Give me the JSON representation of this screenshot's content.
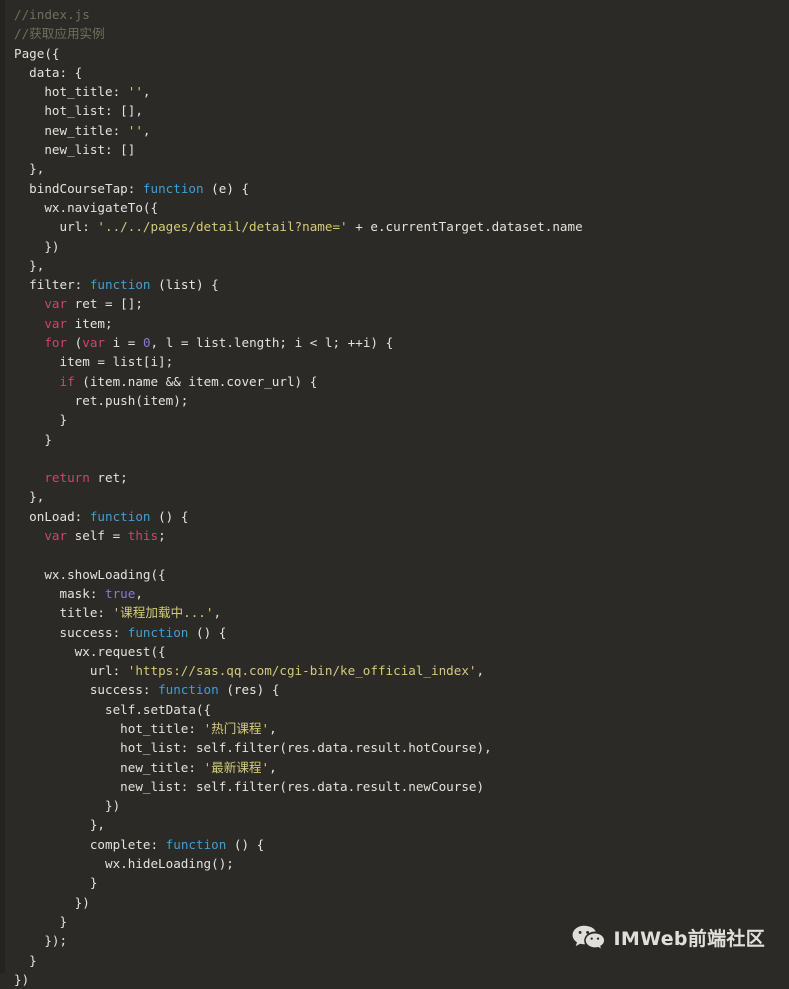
{
  "editor": {
    "language": "javascript",
    "theme_background": "#2b2a26",
    "default_text_color": "#e4e2db",
    "token_colors": {
      "comment": "#6f6f5d",
      "keyword": "#d2436b",
      "function": "#3f9fd6",
      "string": "#d3cb7a",
      "number": "#8a7ad6",
      "parameter": "#c9456a",
      "plain": "#e4e2db"
    }
  },
  "watermark": {
    "icon": "wechat-logo-icon",
    "label": "IMWeb前端社区"
  },
  "code": {
    "lines": [
      [
        {
          "t": "//index.js",
          "c": "comment"
        }
      ],
      [
        {
          "t": "//获取应用实例",
          "c": "comment"
        }
      ],
      [
        {
          "t": "Page({",
          "c": "plain"
        }
      ],
      [
        {
          "t": "  data: {",
          "c": "plain"
        }
      ],
      [
        {
          "t": "    hot_title: ",
          "c": "plain"
        },
        {
          "t": "''",
          "c": "string"
        },
        {
          "t": ",",
          "c": "plain"
        }
      ],
      [
        {
          "t": "    hot_list: [],",
          "c": "plain"
        }
      ],
      [
        {
          "t": "    new_title: ",
          "c": "plain"
        },
        {
          "t": "''",
          "c": "string"
        },
        {
          "t": ",",
          "c": "plain"
        }
      ],
      [
        {
          "t": "    new_list: []",
          "c": "plain"
        }
      ],
      [
        {
          "t": "  },",
          "c": "plain"
        }
      ],
      [
        {
          "t": "  bindCourseTap: ",
          "c": "plain"
        },
        {
          "t": "function",
          "c": "function"
        },
        {
          "t": " ",
          "c": "plain"
        },
        {
          "t": "(e)",
          "c": "parameter"
        },
        {
          "t": " {",
          "c": "plain"
        }
      ],
      [
        {
          "t": "    wx.navigateTo({",
          "c": "plain"
        }
      ],
      [
        {
          "t": "      url: ",
          "c": "plain"
        },
        {
          "t": "'../../pages/detail/detail?name='",
          "c": "string"
        },
        {
          "t": " + e.currentTarget.dataset.name",
          "c": "plain"
        }
      ],
      [
        {
          "t": "    })",
          "c": "plain"
        }
      ],
      [
        {
          "t": "  },",
          "c": "plain"
        }
      ],
      [
        {
          "t": "  filter: ",
          "c": "plain"
        },
        {
          "t": "function",
          "c": "function"
        },
        {
          "t": " ",
          "c": "plain"
        },
        {
          "t": "(list)",
          "c": "parameter"
        },
        {
          "t": " {",
          "c": "plain"
        }
      ],
      [
        {
          "t": "    ",
          "c": "plain"
        },
        {
          "t": "var",
          "c": "keyword"
        },
        {
          "t": " ret = [];",
          "c": "plain"
        }
      ],
      [
        {
          "t": "    ",
          "c": "plain"
        },
        {
          "t": "var",
          "c": "keyword"
        },
        {
          "t": " item;",
          "c": "plain"
        }
      ],
      [
        {
          "t": "    ",
          "c": "plain"
        },
        {
          "t": "for",
          "c": "keyword"
        },
        {
          "t": " (",
          "c": "plain"
        },
        {
          "t": "var",
          "c": "keyword"
        },
        {
          "t": " i = ",
          "c": "plain"
        },
        {
          "t": "0",
          "c": "number"
        },
        {
          "t": ", l = list.length; i < l; ++i) {",
          "c": "plain"
        }
      ],
      [
        {
          "t": "      item = list[i];",
          "c": "plain"
        }
      ],
      [
        {
          "t": "      ",
          "c": "plain"
        },
        {
          "t": "if",
          "c": "keyword"
        },
        {
          "t": " (item.name && item.cover_url) {",
          "c": "plain"
        }
      ],
      [
        {
          "t": "        ret.push(item);",
          "c": "plain"
        }
      ],
      [
        {
          "t": "      }",
          "c": "plain"
        }
      ],
      [
        {
          "t": "    }",
          "c": "plain"
        }
      ],
      [
        {
          "t": "",
          "c": "plain"
        }
      ],
      [
        {
          "t": "    ",
          "c": "plain"
        },
        {
          "t": "return",
          "c": "keyword"
        },
        {
          "t": " ret;",
          "c": "plain"
        }
      ],
      [
        {
          "t": "  },",
          "c": "plain"
        }
      ],
      [
        {
          "t": "  onLoad: ",
          "c": "plain"
        },
        {
          "t": "function",
          "c": "function"
        },
        {
          "t": " ",
          "c": "plain"
        },
        {
          "t": "()",
          "c": "parameter"
        },
        {
          "t": " {",
          "c": "plain"
        }
      ],
      [
        {
          "t": "    ",
          "c": "plain"
        },
        {
          "t": "var",
          "c": "keyword"
        },
        {
          "t": " self = ",
          "c": "plain"
        },
        {
          "t": "this",
          "c": "keyword"
        },
        {
          "t": ";",
          "c": "plain"
        }
      ],
      [
        {
          "t": "",
          "c": "plain"
        }
      ],
      [
        {
          "t": "    wx.showLoading({",
          "c": "plain"
        }
      ],
      [
        {
          "t": "      mask: ",
          "c": "plain"
        },
        {
          "t": "true",
          "c": "number"
        },
        {
          "t": ",",
          "c": "plain"
        }
      ],
      [
        {
          "t": "      title: ",
          "c": "plain"
        },
        {
          "t": "'课程加载中...'",
          "c": "string"
        },
        {
          "t": ",",
          "c": "plain"
        }
      ],
      [
        {
          "t": "      success: ",
          "c": "plain"
        },
        {
          "t": "function",
          "c": "function"
        },
        {
          "t": " ",
          "c": "plain"
        },
        {
          "t": "()",
          "c": "parameter"
        },
        {
          "t": " {",
          "c": "plain"
        }
      ],
      [
        {
          "t": "        wx.request({",
          "c": "plain"
        }
      ],
      [
        {
          "t": "          url: ",
          "c": "plain"
        },
        {
          "t": "'https://sas.qq.com/cgi-bin/ke_official_index'",
          "c": "string"
        },
        {
          "t": ",",
          "c": "plain"
        }
      ],
      [
        {
          "t": "          success: ",
          "c": "plain"
        },
        {
          "t": "function",
          "c": "function"
        },
        {
          "t": " ",
          "c": "plain"
        },
        {
          "t": "(res)",
          "c": "parameter"
        },
        {
          "t": " {",
          "c": "plain"
        }
      ],
      [
        {
          "t": "            self.setData({",
          "c": "plain"
        }
      ],
      [
        {
          "t": "              hot_title: ",
          "c": "plain"
        },
        {
          "t": "'热门课程'",
          "c": "string"
        },
        {
          "t": ",",
          "c": "plain"
        }
      ],
      [
        {
          "t": "              hot_list: self.filter(res.data.result.hotCourse),",
          "c": "plain"
        }
      ],
      [
        {
          "t": "              new_title: ",
          "c": "plain"
        },
        {
          "t": "'最新课程'",
          "c": "string"
        },
        {
          "t": ",",
          "c": "plain"
        }
      ],
      [
        {
          "t": "              new_list: self.filter(res.data.result.newCourse)",
          "c": "plain"
        }
      ],
      [
        {
          "t": "            })",
          "c": "plain"
        }
      ],
      [
        {
          "t": "          },",
          "c": "plain"
        }
      ],
      [
        {
          "t": "          complete: ",
          "c": "plain"
        },
        {
          "t": "function",
          "c": "function"
        },
        {
          "t": " ",
          "c": "plain"
        },
        {
          "t": "()",
          "c": "parameter"
        },
        {
          "t": " {",
          "c": "plain"
        }
      ],
      [
        {
          "t": "            wx.hideLoading();",
          "c": "plain"
        }
      ],
      [
        {
          "t": "          }",
          "c": "plain"
        }
      ],
      [
        {
          "t": "        })",
          "c": "plain"
        }
      ],
      [
        {
          "t": "      }",
          "c": "plain"
        }
      ],
      [
        {
          "t": "    });",
          "c": "plain"
        }
      ],
      [
        {
          "t": "  }",
          "c": "plain"
        }
      ],
      [
        {
          "t": "})",
          "c": "plain"
        }
      ]
    ]
  }
}
